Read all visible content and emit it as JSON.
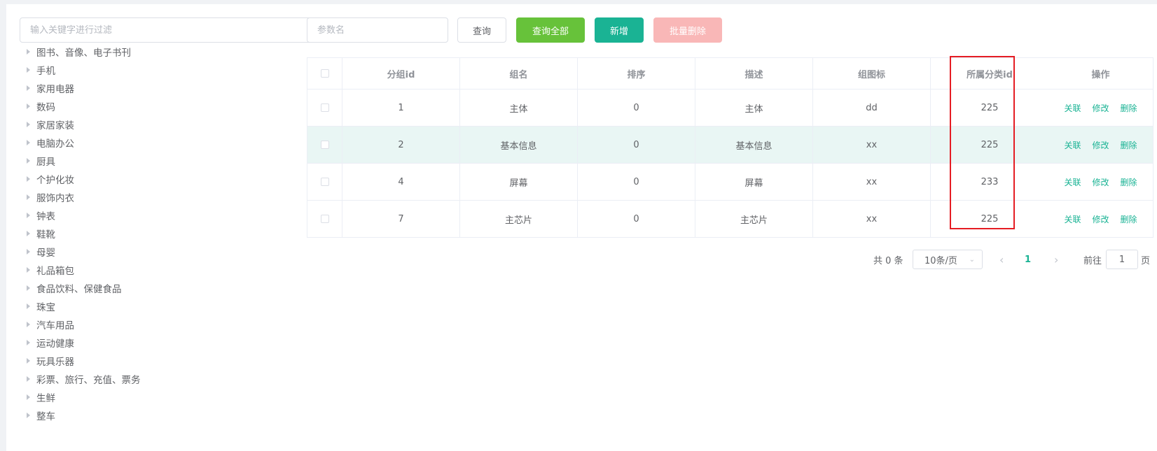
{
  "filter": {
    "placeholder": "输入关键字进行过滤"
  },
  "tree": [
    "图书、音像、电子书刊",
    "手机",
    "家用电器",
    "数码",
    "家居家装",
    "电脑办公",
    "厨具",
    "个护化妆",
    "服饰内衣",
    "钟表",
    "鞋靴",
    "母婴",
    "礼品箱包",
    "食品饮料、保健食品",
    "珠宝",
    "汽车用品",
    "运动健康",
    "玩具乐器",
    "彩票、旅行、充值、票务",
    "生鲜",
    "整车"
  ],
  "toolbar": {
    "param_placeholder": "参数名",
    "query_label": "查询",
    "query_all_label": "查询全部",
    "add_label": "新增",
    "batch_delete_label": "批量删除"
  },
  "table": {
    "headers": [
      "分组id",
      "组名",
      "排序",
      "描述",
      "组图标",
      "所属分类id",
      "操作"
    ],
    "rows": [
      {
        "id": "1",
        "name": "主体",
        "sort": "0",
        "desc": "主体",
        "icon": "dd",
        "catelog": "225"
      },
      {
        "id": "2",
        "name": "基本信息",
        "sort": "0",
        "desc": "基本信息",
        "icon": "xx",
        "catelog": "225"
      },
      {
        "id": "4",
        "name": "屏幕",
        "sort": "0",
        "desc": "屏幕",
        "icon": "xx",
        "catelog": "233"
      },
      {
        "id": "7",
        "name": "主芯片",
        "sort": "0",
        "desc": "主芯片",
        "icon": "xx",
        "catelog": "225"
      }
    ],
    "ops": {
      "relate": "关联",
      "edit": "修改",
      "delete": "删除"
    }
  },
  "pagination": {
    "total_text": "共 0 条",
    "page_size": "10条/页",
    "current_page": "1",
    "goto_prefix": "前往",
    "goto_value": "1",
    "goto_suffix": "页"
  },
  "colors": {
    "accent": "#1ab394",
    "success": "#67c23a",
    "danger_disabled": "#f9b7b7",
    "highlight_box": "#e51c23"
  }
}
